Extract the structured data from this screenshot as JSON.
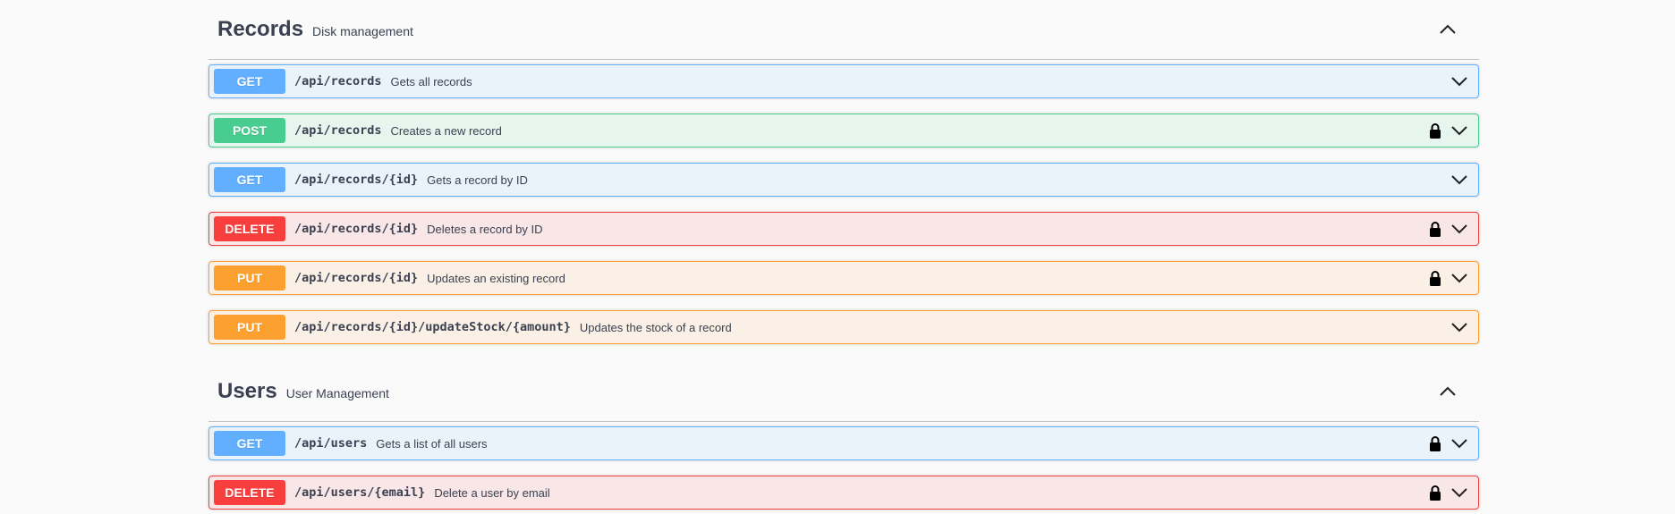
{
  "colors": {
    "get": "#61affe",
    "post": "#49cc90",
    "delete": "#f93e3e",
    "put": "#fca130",
    "text": "#3b4151"
  },
  "icons": {
    "lock": "lock-icon",
    "expand": "chevron-down-icon",
    "collapse": "chevron-up-icon"
  },
  "sections": [
    {
      "title": "Records",
      "description": "Disk management",
      "operations": [
        {
          "method": "GET",
          "path": "/api/records",
          "summary": "Gets all records",
          "locked": false
        },
        {
          "method": "POST",
          "path": "/api/records",
          "summary": "Creates a new record",
          "locked": true
        },
        {
          "method": "GET",
          "path": "/api/records/{id}",
          "summary": "Gets a record by ID",
          "locked": false
        },
        {
          "method": "DELETE",
          "path": "/api/records/{id}",
          "summary": "Deletes a record by ID",
          "locked": true
        },
        {
          "method": "PUT",
          "path": "/api/records/{id}",
          "summary": "Updates an existing record",
          "locked": true
        },
        {
          "method": "PUT",
          "path": "/api/records/{id}/updateStock/{amount}",
          "summary": "Updates the stock of a record",
          "locked": false
        }
      ]
    },
    {
      "title": "Users",
      "description": "User Management",
      "operations": [
        {
          "method": "GET",
          "path": "/api/users",
          "summary": "Gets a list of all users",
          "locked": true
        },
        {
          "method": "DELETE",
          "path": "/api/users/{email}",
          "summary": "Delete a user by email",
          "locked": true
        }
      ]
    }
  ]
}
